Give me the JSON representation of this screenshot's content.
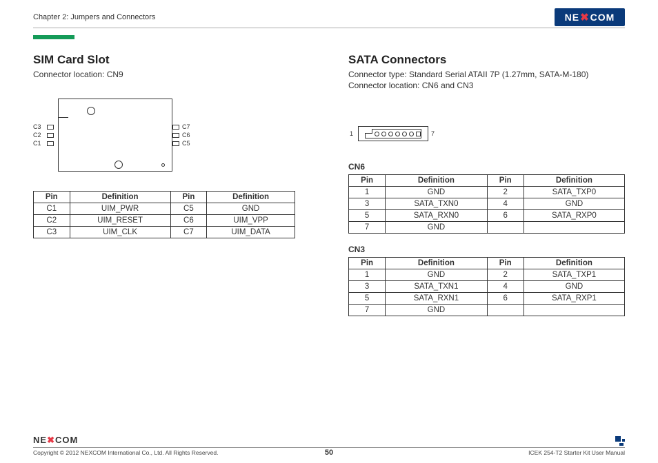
{
  "header": {
    "chapter": "Chapter 2: Jumpers and Connectors",
    "brand": "NEXCOM"
  },
  "left": {
    "title": "SIM Card Slot",
    "loc": "Connector location: CN9",
    "pins_labels_left": [
      "C3",
      "C2",
      "C1"
    ],
    "pins_labels_right": [
      "C7",
      "C6",
      "C5"
    ],
    "table_headers": [
      "Pin",
      "Definition",
      "Pin",
      "Definition"
    ],
    "table": [
      [
        "C1",
        "UIM_PWR",
        "C5",
        "GND"
      ],
      [
        "C2",
        "UIM_RESET",
        "C6",
        "UIM_VPP"
      ],
      [
        "C3",
        "UIM_CLK",
        "C7",
        "UIM_DATA"
      ]
    ]
  },
  "right": {
    "title": "SATA Connectors",
    "type_line": "Connector type: Standard Serial ATAII 7P (1.27mm, SATA-M-180)",
    "loc": "Connector location: CN6 and CN3",
    "pin1": "1",
    "pin7": "7",
    "cn6_title": "CN6",
    "cn3_title": "CN3",
    "table_headers": [
      "Pin",
      "Definition",
      "Pin",
      "Definition"
    ],
    "cn6": [
      [
        "1",
        "GND",
        "2",
        "SATA_TXP0"
      ],
      [
        "3",
        "SATA_TXN0",
        "4",
        "GND"
      ],
      [
        "5",
        "SATA_RXN0",
        "6",
        "SATA_RXP0"
      ],
      [
        "7",
        "GND",
        "",
        ""
      ]
    ],
    "cn3": [
      [
        "1",
        "GND",
        "2",
        "SATA_TXP1"
      ],
      [
        "3",
        "SATA_TXN1",
        "4",
        "GND"
      ],
      [
        "5",
        "SATA_RXN1",
        "6",
        "SATA_RXP1"
      ],
      [
        "7",
        "GND",
        "",
        ""
      ]
    ]
  },
  "footer": {
    "brand": "NEXCOM",
    "copyright": "Copyright © 2012 NEXCOM International Co., Ltd. All Rights Reserved.",
    "page": "50",
    "manual": "ICEK 254-T2 Starter Kit User Manual"
  }
}
